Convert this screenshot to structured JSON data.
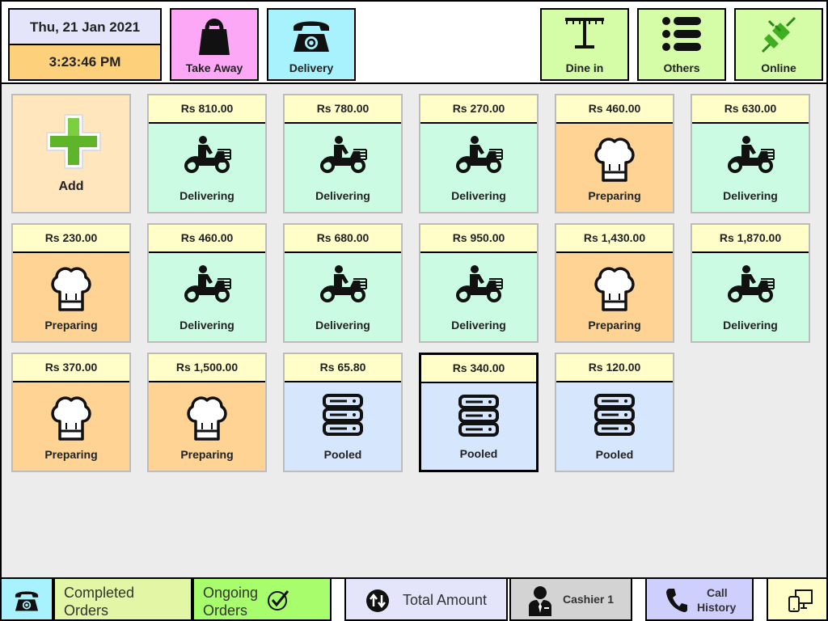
{
  "header": {
    "date": "Thu, 21 Jan 2021",
    "time": "3:23:46 PM",
    "buttons": {
      "take_away": "Take Away",
      "delivery": "Delivery",
      "dine_in": "Dine in",
      "others": "Others",
      "online": "Online"
    },
    "colors": {
      "take_away": "#fda8f6",
      "delivery": "#a8f2fd",
      "dine_in": "#d5fda8",
      "others": "#d5fda8",
      "online": "#d5fda8"
    }
  },
  "add_tile": {
    "label": "Add"
  },
  "orders": [
    {
      "price": "Rs 810.00",
      "status": "Delivering",
      "icon": "scooter-icon"
    },
    {
      "price": "Rs 780.00",
      "status": "Delivering",
      "icon": "scooter-icon"
    },
    {
      "price": "Rs 270.00",
      "status": "Delivering",
      "icon": "scooter-icon"
    },
    {
      "price": "Rs 460.00",
      "status": "Preparing",
      "icon": "chef-hat-icon"
    },
    {
      "price": "Rs 630.00",
      "status": "Delivering",
      "icon": "scooter-icon"
    },
    {
      "price": "Rs 230.00",
      "status": "Preparing",
      "icon": "chef-hat-icon"
    },
    {
      "price": "Rs 460.00",
      "status": "Delivering",
      "icon": "scooter-icon"
    },
    {
      "price": "Rs 680.00",
      "status": "Delivering",
      "icon": "scooter-icon"
    },
    {
      "price": "Rs 950.00",
      "status": "Delivering",
      "icon": "scooter-icon"
    },
    {
      "price": "Rs 1,430.00",
      "status": "Preparing",
      "icon": "chef-hat-icon"
    },
    {
      "price": "Rs 1,870.00",
      "status": "Delivering",
      "icon": "scooter-icon"
    },
    {
      "price": "Rs 370.00",
      "status": "Preparing",
      "icon": "chef-hat-icon"
    },
    {
      "price": "Rs 1,500.00",
      "status": "Preparing",
      "icon": "chef-hat-icon"
    },
    {
      "price": "Rs 65.80",
      "status": "Pooled",
      "icon": "server-stack-icon"
    },
    {
      "price": "Rs 340.00",
      "status": "Pooled",
      "icon": "server-stack-icon",
      "selected": true
    },
    {
      "price": "Rs 120.00",
      "status": "Pooled",
      "icon": "server-stack-icon"
    }
  ],
  "footer": {
    "completed_orders_line1": "Completed",
    "completed_orders_line2": "Orders",
    "ongoing_orders_line1": "Ongoing",
    "ongoing_orders_line2": "Orders",
    "total_amount": "Total Amount",
    "cashier": "Cashier 1",
    "call_history_line1": "Call",
    "call_history_line2": "History"
  },
  "icons": {
    "phone": "rotary-phone-icon",
    "check": "checkmark-circle-icon",
    "total": "sort-arrows-icon",
    "cashier": "person-tie-icon",
    "call": "phone-handset-icon",
    "devices": "devices-icon"
  }
}
